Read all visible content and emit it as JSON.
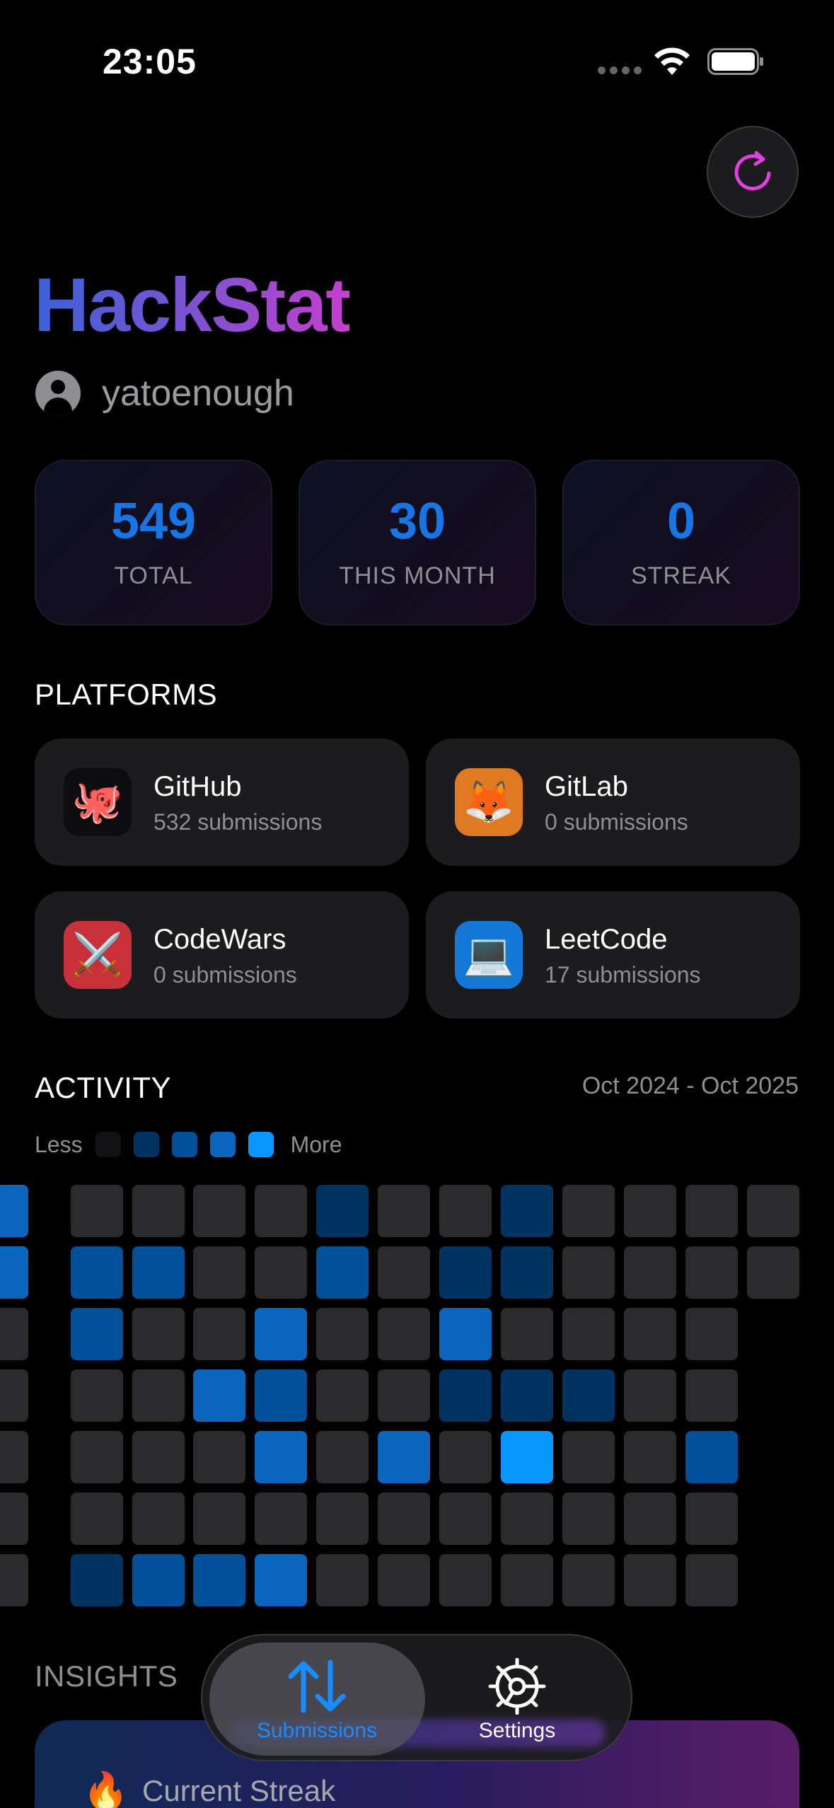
{
  "status_bar": {
    "time": "23:05"
  },
  "header": {
    "title": "HackStat",
    "username": "yatoenough"
  },
  "stats": [
    {
      "value": "549",
      "label": "TOTAL"
    },
    {
      "value": "30",
      "label": "THIS MONTH"
    },
    {
      "value": "0",
      "label": "STREAK"
    }
  ],
  "platforms": {
    "title": "PLATFORMS",
    "items": [
      {
        "name": "GitHub",
        "count": "532 submissions",
        "emoji": "🐙",
        "icon_bg": "#0d0d0f"
      },
      {
        "name": "GitLab",
        "count": "0 submissions",
        "emoji": "🦊",
        "icon_bg": "#e07a22"
      },
      {
        "name": "CodeWars",
        "count": "0 submissions",
        "emoji": "⚔️",
        "icon_bg": "#c8303a"
      },
      {
        "name": "LeetCode",
        "count": "17 submissions",
        "emoji": "💻",
        "icon_bg": "#1478d6"
      }
    ]
  },
  "activity": {
    "title": "ACTIVITY",
    "range": "Oct 2024 - Oct 2025",
    "legend_less": "Less",
    "legend_more": "More",
    "levels": [
      "#2b2b2d",
      "#003262",
      "#00509a",
      "#0a66bd",
      "#0a96ff"
    ],
    "legend_levels": [
      "#111113",
      "#003262",
      "#00509a",
      "#0a66bd",
      "#0a96ff"
    ],
    "grid": [
      [
        3,
        0,
        0,
        0,
        0,
        1,
        0,
        0,
        1,
        0,
        0,
        0,
        0
      ],
      [
        3,
        2,
        2,
        0,
        0,
        2,
        0,
        1,
        1,
        0,
        0,
        0,
        0
      ],
      [
        0,
        2,
        0,
        0,
        3,
        0,
        0,
        3,
        0,
        0,
        0,
        0,
        -1
      ],
      [
        0,
        0,
        0,
        3,
        2,
        0,
        0,
        1,
        1,
        1,
        0,
        0,
        -1
      ],
      [
        0,
        0,
        0,
        0,
        3,
        0,
        3,
        0,
        4,
        0,
        0,
        2,
        -1
      ],
      [
        0,
        0,
        0,
        0,
        0,
        0,
        0,
        0,
        0,
        0,
        0,
        0,
        -1
      ],
      [
        0,
        1,
        2,
        2,
        3,
        0,
        0,
        0,
        0,
        0,
        0,
        0,
        -1
      ]
    ]
  },
  "insights": {
    "title": "INSIGHTS",
    "card_title": "Current Streak",
    "card_emoji": "🔥"
  },
  "tab_bar": {
    "tabs": [
      {
        "label": "Submissions",
        "color": "#1a8cff"
      },
      {
        "label": "Settings",
        "color": "#ffffff"
      }
    ]
  }
}
